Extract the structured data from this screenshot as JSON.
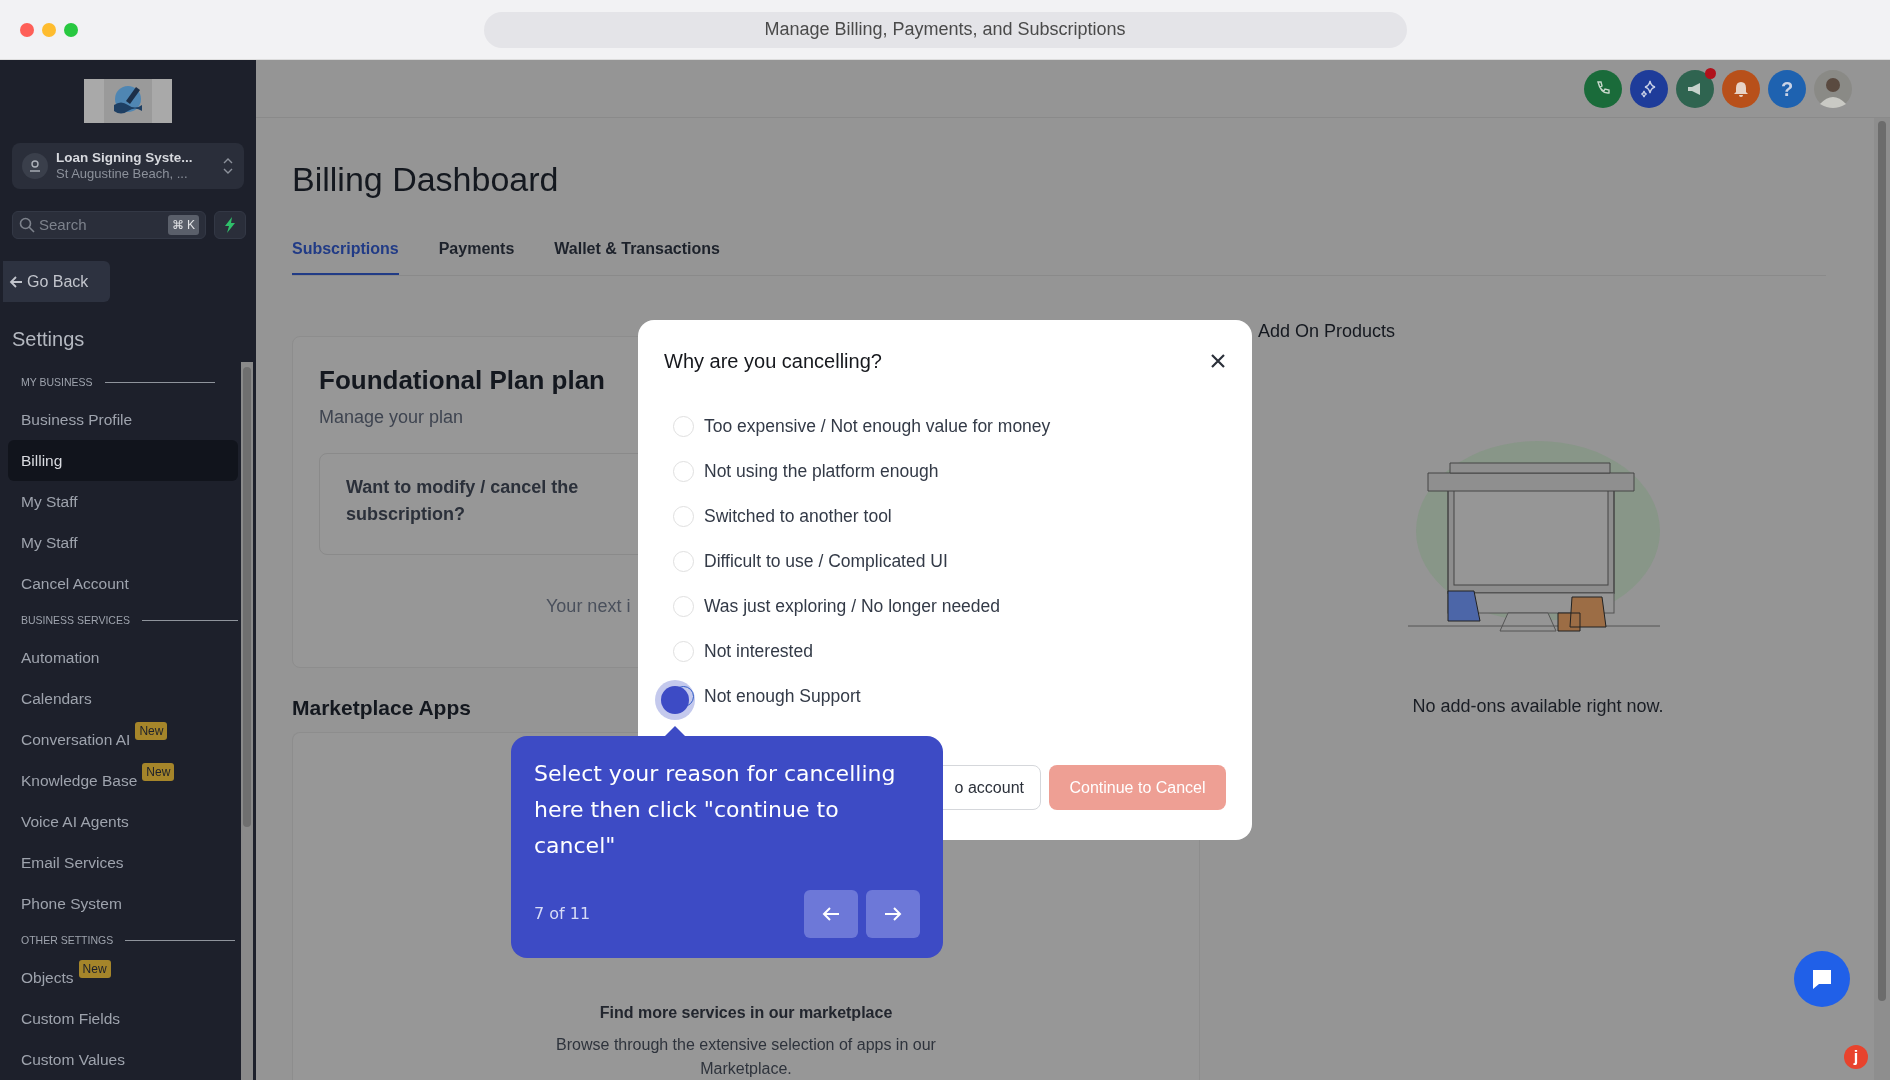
{
  "browser": {
    "title": "Manage Billing, Payments, and Subscriptions"
  },
  "sidebar": {
    "account": {
      "name": "Loan Signing Syste...",
      "location": "St Augustine Beach, ..."
    },
    "search": {
      "placeholder": "Search",
      "shortcut": "⌘ K"
    },
    "back_label": "Go Back",
    "heading": "Settings",
    "sections": [
      {
        "title": "MY BUSINESS",
        "items": [
          {
            "label": "Business Profile",
            "selected": false
          },
          {
            "label": "Billing",
            "selected": true
          },
          {
            "label": "My Staff",
            "selected": false
          },
          {
            "label": "My Staff",
            "selected": false
          },
          {
            "label": "Cancel Account",
            "selected": false
          }
        ]
      },
      {
        "title": "BUSINESS SERVICES",
        "items": [
          {
            "label": "Automation",
            "selected": false
          },
          {
            "label": "Calendars",
            "selected": false
          },
          {
            "label": "Conversation AI",
            "selected": false,
            "badge": "New"
          },
          {
            "label": "Knowledge Base",
            "selected": false,
            "badge": "New"
          },
          {
            "label": "Voice AI Agents",
            "selected": false
          },
          {
            "label": "Email Services",
            "selected": false
          },
          {
            "label": "Phone System",
            "selected": false
          }
        ]
      },
      {
        "title": "OTHER SETTINGS",
        "items": [
          {
            "label": "Objects",
            "selected": false,
            "badge": "New"
          },
          {
            "label": "Custom Fields",
            "selected": false
          },
          {
            "label": "Custom Values",
            "selected": false
          }
        ]
      }
    ]
  },
  "header_icons": [
    {
      "kind": "phone",
      "dot": false
    },
    {
      "kind": "sparkle",
      "dot": false
    },
    {
      "kind": "megaphone",
      "dot": true
    },
    {
      "kind": "bell",
      "dot": false
    },
    {
      "kind": "help",
      "label": "?",
      "dot": false
    },
    {
      "kind": "avatar",
      "dot": false
    }
  ],
  "page": {
    "title": "Billing Dashboard",
    "tabs": [
      {
        "label": "Subscriptions",
        "selected": true
      },
      {
        "label": "Payments",
        "selected": false
      },
      {
        "label": "Wallet & Transactions",
        "selected": false
      }
    ],
    "plan_card": {
      "title": "Foundational Plan plan",
      "subtitle": "Manage your plan",
      "prompt": "Want to modify / cancel the subscription?",
      "next_invoice": "Your next i"
    },
    "marketplace": {
      "heading": "Marketplace Apps",
      "title": "Find more services in our marketplace",
      "text": "Browse through the extensive selection of apps in our Marketplace."
    },
    "addons": {
      "heading": "Add On Products",
      "empty_text": "No add-ons available right now."
    }
  },
  "modal": {
    "title": "Why are you cancelling?",
    "options": [
      {
        "label": "Too expensive / Not enough value for money",
        "focused": false
      },
      {
        "label": "Not using the platform enough",
        "focused": false
      },
      {
        "label": "Switched to another tool",
        "focused": false
      },
      {
        "label": "Difficult to use / Complicated UI",
        "focused": false
      },
      {
        "label": "Was just exploring / No longer needed",
        "focused": false
      },
      {
        "label": "Not interested",
        "focused": false
      },
      {
        "label": "Not enough Support",
        "focused": true
      }
    ],
    "buttons": [
      {
        "label": "o account",
        "kind": "secondary"
      },
      {
        "label": "Continue to Cancel",
        "kind": "danger"
      }
    ]
  },
  "tooltip": {
    "text": "Select your reason for cancelling here then click \"continue to cancel\"",
    "step": "7 of 11"
  },
  "launcher_badge": "j"
}
